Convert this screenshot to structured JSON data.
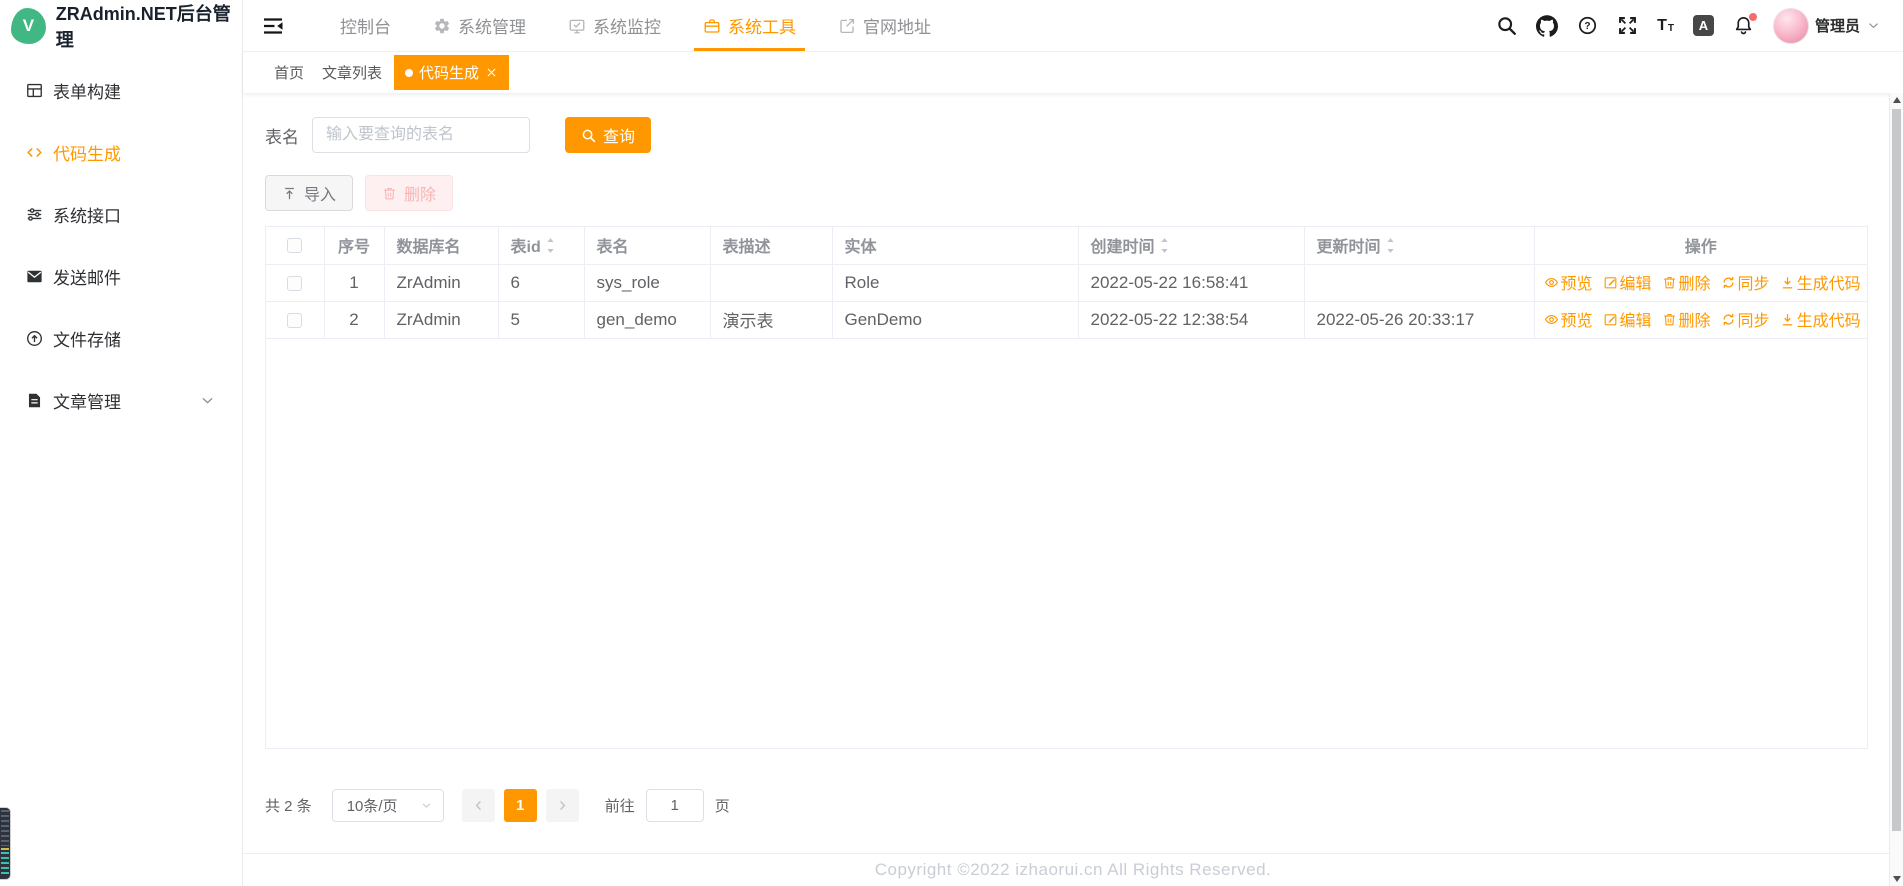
{
  "app": {
    "logo_letter": "V",
    "title": "ZRAdmin.NET后台管理"
  },
  "topnav": {
    "menus": [
      {
        "label": "控制台"
      },
      {
        "label": "系统管理",
        "icon": "gear-icon"
      },
      {
        "label": "系统监控",
        "icon": "monitor-icon"
      },
      {
        "label": "系统工具",
        "icon": "toolbox-icon",
        "active": true
      },
      {
        "label": "官网地址",
        "icon": "external-link-icon"
      }
    ],
    "tools": [
      "search-icon",
      "github-icon",
      "help-icon",
      "fullscreen-icon",
      "font-size-icon",
      "language-icon",
      "notification-bell-icon"
    ],
    "icon_glyphs": {
      "help": "?",
      "font_size_large": "T",
      "font_size_small": "T",
      "language": "A"
    },
    "user": {
      "name": "管理员"
    }
  },
  "sidebar": {
    "items": [
      {
        "label": "表单构建",
        "icon": "form-grid-icon"
      },
      {
        "label": "代码生成",
        "icon": "code-icon",
        "active": true
      },
      {
        "label": "系统接口",
        "icon": "sliders-icon"
      },
      {
        "label": "发送邮件",
        "icon": "mail-icon"
      },
      {
        "label": "文件存储",
        "icon": "cloud-upload-icon"
      },
      {
        "label": "文章管理",
        "icon": "document-icon",
        "expandable": true
      }
    ]
  },
  "tabs": [
    {
      "label": "首页"
    },
    {
      "label": "文章列表"
    },
    {
      "label": "代码生成",
      "active": true,
      "closable": true
    }
  ],
  "search": {
    "label": "表名",
    "placeholder": "输入要查询的表名",
    "button": "查询"
  },
  "toolbar": {
    "import": "导入",
    "delete": "删除"
  },
  "table": {
    "columns": [
      {
        "label": "",
        "type": "checkbox"
      },
      {
        "label": "序号"
      },
      {
        "label": "数据库名"
      },
      {
        "label": "表id",
        "sortable": true
      },
      {
        "label": "表名"
      },
      {
        "label": "表描述"
      },
      {
        "label": "实体"
      },
      {
        "label": "创建时间",
        "sortable": true
      },
      {
        "label": "更新时间",
        "sortable": true
      },
      {
        "label": "操作"
      }
    ],
    "rows": [
      {
        "seq": "1",
        "db_name": "ZrAdmin",
        "table_id": "6",
        "table_name": "sys_role",
        "description": "",
        "entity": "Role",
        "created_at": "2022-05-22 16:58:41",
        "updated_at": ""
      },
      {
        "seq": "2",
        "db_name": "ZrAdmin",
        "table_id": "5",
        "table_name": "gen_demo",
        "description": "演示表",
        "entity": "GenDemo",
        "created_at": "2022-05-22 12:38:54",
        "updated_at": "2022-05-26 20:33:17"
      }
    ],
    "actions": [
      {
        "label": "预览",
        "icon": "eye-icon"
      },
      {
        "label": "编辑",
        "icon": "edit-icon"
      },
      {
        "label": "删除",
        "icon": "trash-icon"
      },
      {
        "label": "同步",
        "icon": "sync-icon"
      },
      {
        "label": "生成代码",
        "icon": "download-icon"
      }
    ]
  },
  "pagination": {
    "total": "共 2 条",
    "page_size": "10条/页",
    "current_page": "1",
    "goto_label": "前往",
    "goto_value": "1",
    "unit": "页"
  },
  "footer": {
    "copyright": "Copyright ©2022 izhaorui.cn All Rights Reserved."
  },
  "colors": {
    "accent": "#ff9800",
    "danger": "#f56c6c",
    "logo_green": "#41b883"
  }
}
